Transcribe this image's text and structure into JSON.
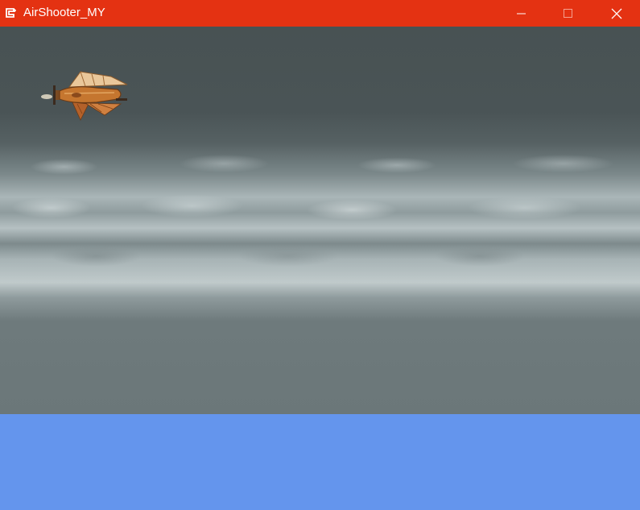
{
  "window": {
    "title": "AirShooter_MY",
    "titlebar_color": "#E43212",
    "app_icon": "game-app-icon",
    "controls": {
      "minimize_icon": "minimize-icon",
      "maximize_icon": "maximize-icon",
      "close_icon": "close-icon"
    }
  },
  "game": {
    "background_color": "#6495ED",
    "sky_colors": [
      "#485253",
      "#c0cacb",
      "#6b7779"
    ],
    "player_sprite": "steampunk-airship"
  }
}
